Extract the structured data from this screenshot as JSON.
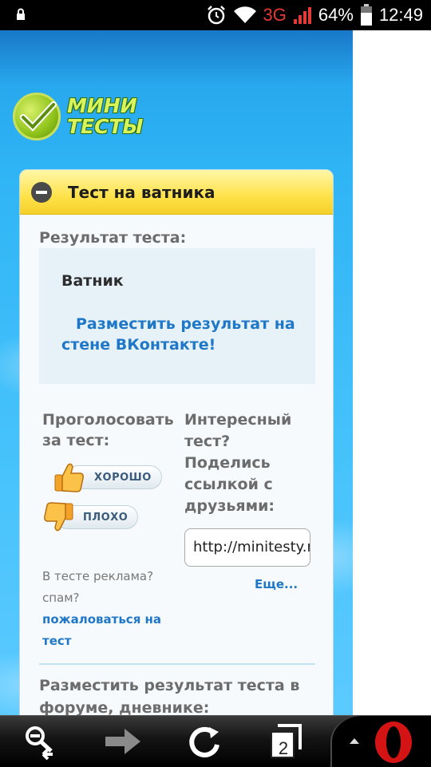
{
  "status_bar": {
    "network": "3G",
    "battery": "64%",
    "time": "12:49"
  },
  "site": {
    "logo_text_line1": "МИНИ",
    "logo_text_line2": "ТЕСТЫ"
  },
  "card": {
    "title": "Тест на ватника",
    "result_label": "Результат теста:",
    "result_name": "Ватник",
    "share_vk": "Разместить результат на стене ВКонтакте!",
    "vote_title": "Проголосовать за тест:",
    "vote_good": "ХОРОШО",
    "vote_bad": "ПЛОХО",
    "complain_text": "В тесте реклама? спам?",
    "complain_link": "пожаловаться на тест",
    "share_title": "Интересный тест? Поделись ссылкой с друзьями:",
    "share_url": "http://minitesty.ru",
    "more_link": "Еще...",
    "forum_title": "Разместить результат теста в форуме, дневнике:"
  },
  "navbar": {
    "tabs_count": "2"
  },
  "colors": {
    "link": "#1f77c7",
    "header_yellow": "#ffe24a",
    "site_blue": "#2fb4f5"
  }
}
